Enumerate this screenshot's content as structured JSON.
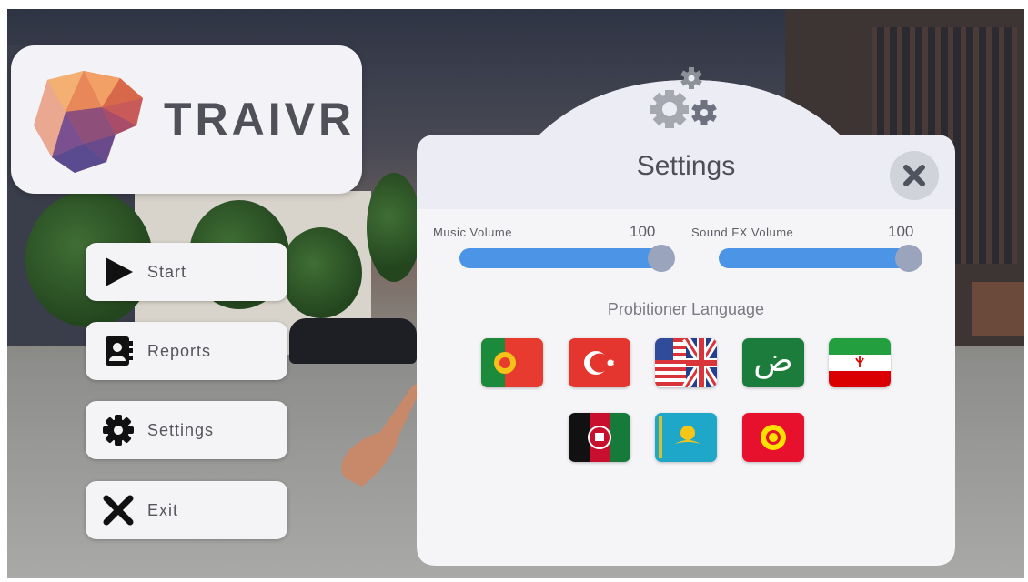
{
  "logo": {
    "text": "TRAIVR"
  },
  "menu": [
    {
      "label": "Start",
      "icon": "play-icon"
    },
    {
      "label": "Reports",
      "icon": "contact-book-icon"
    },
    {
      "label": "Settings",
      "icon": "gear-icon"
    },
    {
      "label": "Exit",
      "icon": "x-icon"
    }
  ],
  "settings": {
    "title": "Settings",
    "close_icon": "close-icon",
    "header_icon": "gears-icon",
    "music": {
      "label": "Music Volume",
      "value": "100",
      "level": 1.0
    },
    "sfx": {
      "label": "Sound FX Volume",
      "value": "100",
      "level": 1.0
    },
    "language_heading": "Probitioner Language",
    "languages": [
      {
        "flag": "portugal-flag-icon"
      },
      {
        "flag": "turkey-flag-icon"
      },
      {
        "flag": "usa-uk-flag-icon"
      },
      {
        "flag": "arabic-letter-icon",
        "glyph": "ض"
      },
      {
        "flag": "iran-flag-icon"
      },
      {
        "flag": "afghanistan-flag-icon"
      },
      {
        "flag": "kazakhstan-flag-icon"
      },
      {
        "flag": "kyrgyzstan-flag-icon"
      }
    ]
  },
  "colors": {
    "accent": "#4b94e6",
    "panel": "#f4f4f8",
    "slider_knob": "#9aa4bc"
  }
}
